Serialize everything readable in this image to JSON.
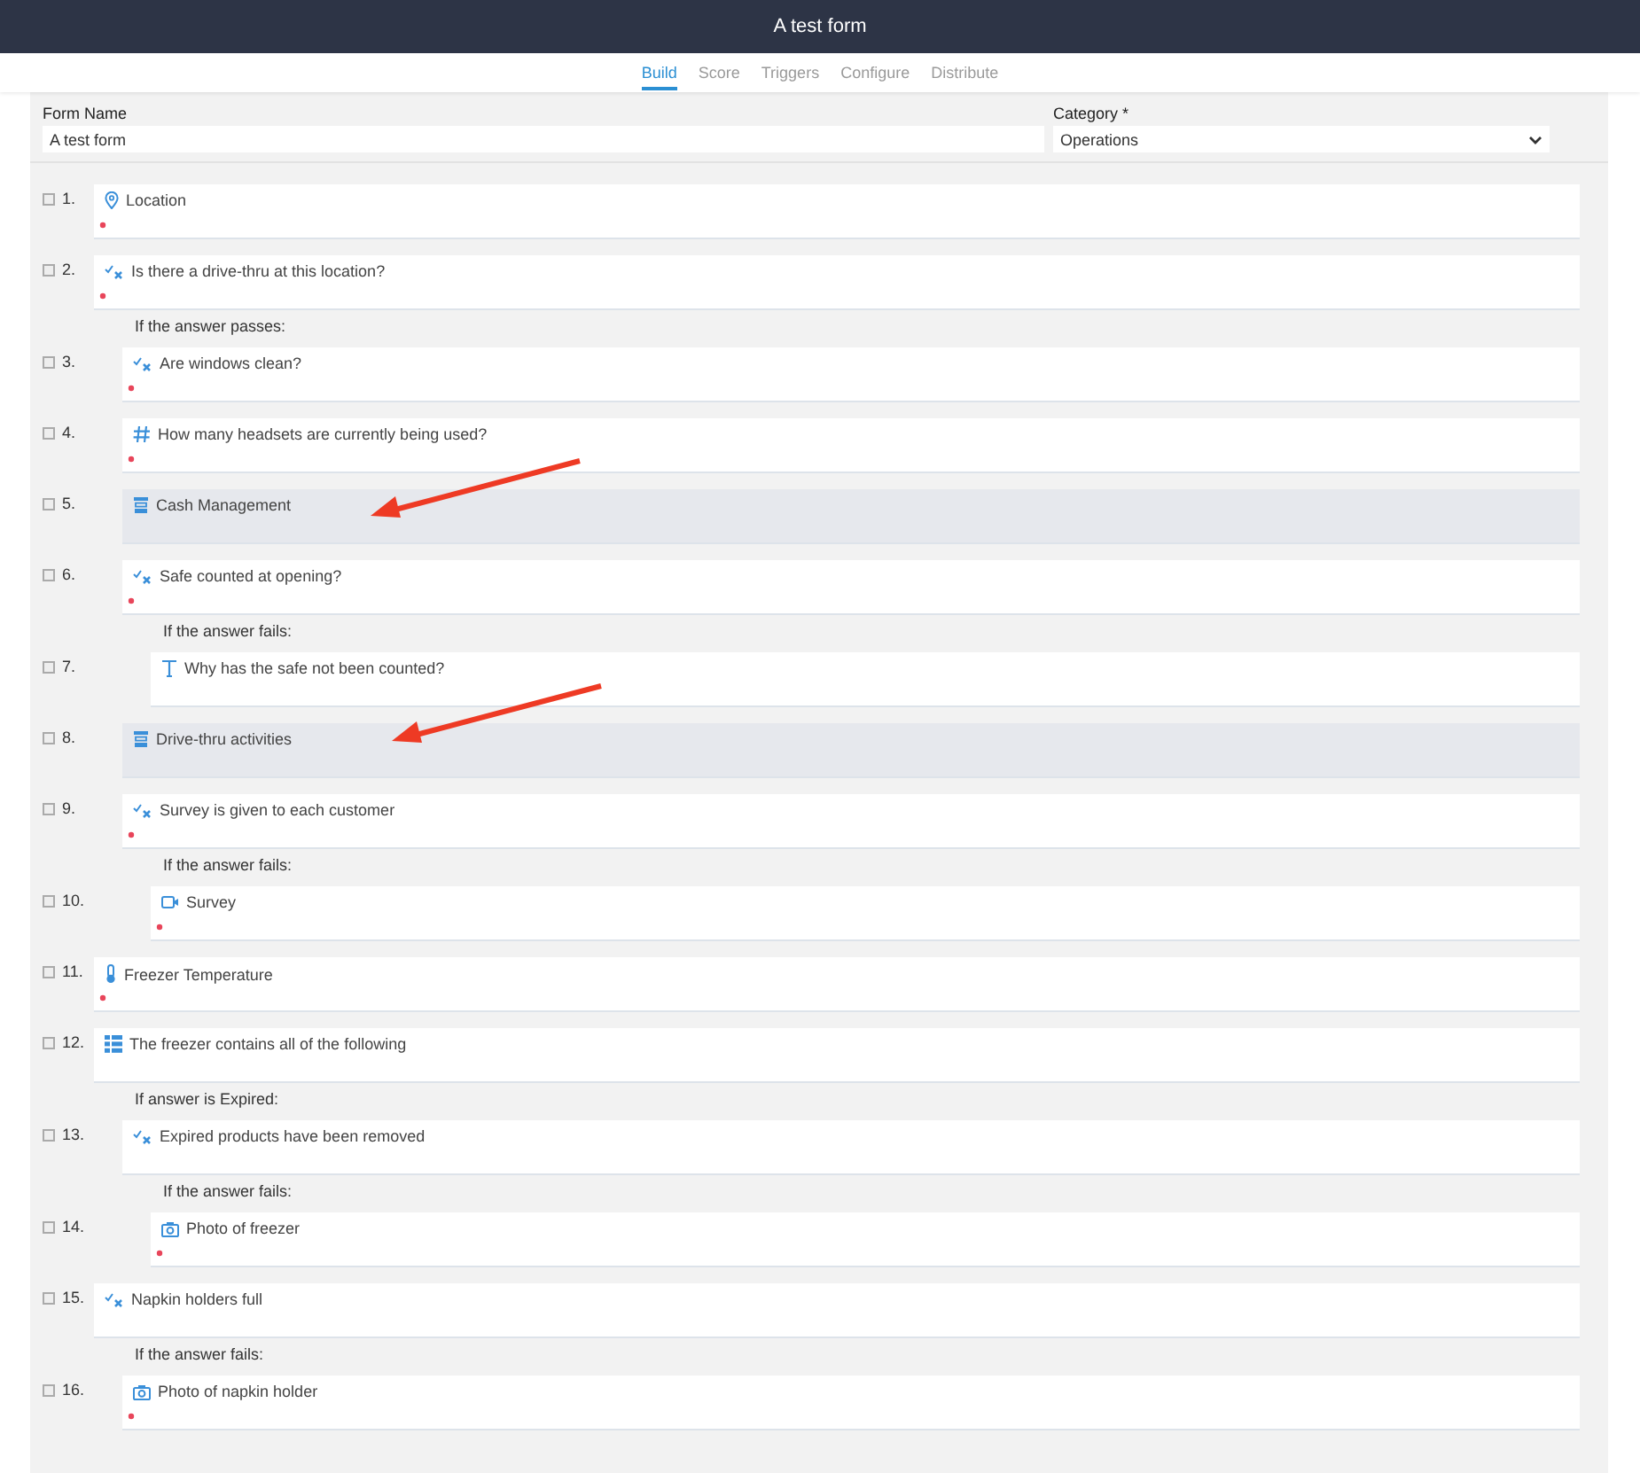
{
  "window": {
    "title": "A test form"
  },
  "tabs": [
    {
      "label": "Build",
      "selected": true
    },
    {
      "label": "Score",
      "selected": false
    },
    {
      "label": "Triggers",
      "selected": false
    },
    {
      "label": "Configure",
      "selected": false
    },
    {
      "label": "Distribute",
      "selected": false
    }
  ],
  "form_name": {
    "label": "Form Name",
    "value": "A test form"
  },
  "category": {
    "label": "Category *",
    "value": "Operations"
  },
  "questions": [
    {
      "number": "1.",
      "checked": false,
      "kind": "location",
      "title": "Location",
      "required": true
    },
    {
      "number": "2.",
      "checked": false,
      "kind": "passfail",
      "title": "Is there a drive-thru at this location?",
      "required": true,
      "branch": {
        "label": "If the answer passes:",
        "children": [
          {
            "number": "3.",
            "checked": false,
            "kind": "passfail",
            "title": "Are windows clean?",
            "required": true
          },
          {
            "number": "4.",
            "checked": false,
            "kind": "number",
            "title": "How many headsets are currently being used?",
            "required": true
          },
          {
            "number": "5.",
            "checked": false,
            "kind": "section",
            "title": "Cash Management",
            "required": false
          },
          {
            "number": "6.",
            "checked": false,
            "kind": "passfail",
            "title": "Safe counted at opening?",
            "required": true,
            "branch": {
              "label": "If the answer fails:",
              "children": [
                {
                  "number": "7.",
                  "checked": false,
                  "kind": "text",
                  "title": "Why has the safe not been counted?",
                  "required": false
                }
              ]
            }
          },
          {
            "number": "8.",
            "checked": false,
            "kind": "section",
            "title": "Drive-thru activities",
            "required": false
          },
          {
            "number": "9.",
            "checked": false,
            "kind": "passfail",
            "title": "Survey is given to each customer",
            "required": true,
            "branch": {
              "label": "If the answer fails:",
              "children": [
                {
                  "number": "10.",
                  "checked": false,
                  "kind": "video",
                  "title": "Survey",
                  "required": true
                }
              ]
            }
          }
        ]
      }
    },
    {
      "number": "11.",
      "checked": false,
      "kind": "temperature",
      "title": "Freezer Temperature",
      "required": true
    },
    {
      "number": "12.",
      "checked": false,
      "kind": "multi",
      "title": "The freezer contains all of the following",
      "required": false,
      "branch": {
        "label": "If answer is Expired:",
        "children": [
          {
            "number": "13.",
            "checked": false,
            "kind": "passfail",
            "title": "Expired products have been removed",
            "required": false,
            "branch": {
              "label": "If the answer fails:",
              "children": [
                {
                  "number": "14.",
                  "checked": false,
                  "kind": "photo",
                  "title": "Photo of freezer",
                  "required": true
                }
              ]
            }
          }
        ]
      }
    },
    {
      "number": "15.",
      "checked": false,
      "kind": "passfail",
      "title": "Napkin holders full",
      "required": false,
      "branch": {
        "label": "If the answer fails:",
        "children": [
          {
            "number": "16.",
            "checked": false,
            "kind": "photo",
            "title": "Photo of napkin holder",
            "required": true
          }
        ]
      }
    }
  ]
}
